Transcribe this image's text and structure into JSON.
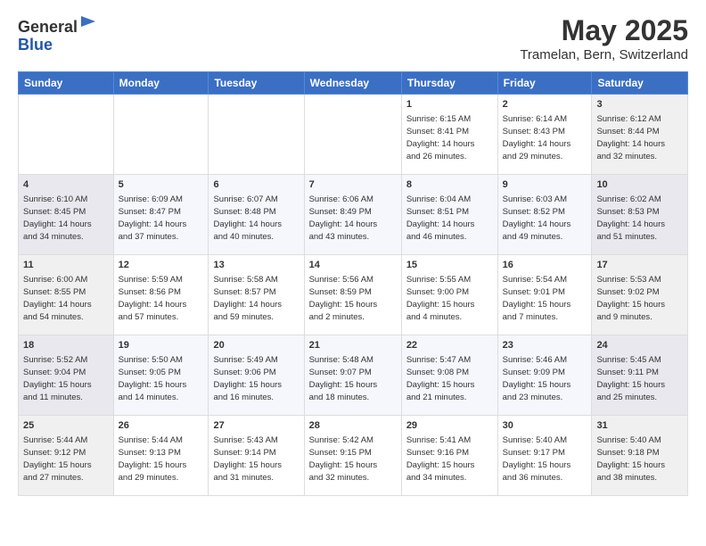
{
  "header": {
    "logo_general": "General",
    "logo_blue": "Blue",
    "main_title": "May 2025",
    "subtitle": "Tramelan, Bern, Switzerland"
  },
  "calendar": {
    "days_of_week": [
      "Sunday",
      "Monday",
      "Tuesday",
      "Wednesday",
      "Thursday",
      "Friday",
      "Saturday"
    ],
    "weeks": [
      [
        {
          "day": "",
          "info": ""
        },
        {
          "day": "",
          "info": ""
        },
        {
          "day": "",
          "info": ""
        },
        {
          "day": "",
          "info": ""
        },
        {
          "day": "1",
          "info": "Sunrise: 6:15 AM\nSunset: 8:41 PM\nDaylight: 14 hours\nand 26 minutes."
        },
        {
          "day": "2",
          "info": "Sunrise: 6:14 AM\nSunset: 8:43 PM\nDaylight: 14 hours\nand 29 minutes."
        },
        {
          "day": "3",
          "info": "Sunrise: 6:12 AM\nSunset: 8:44 PM\nDaylight: 14 hours\nand 32 minutes."
        }
      ],
      [
        {
          "day": "4",
          "info": "Sunrise: 6:10 AM\nSunset: 8:45 PM\nDaylight: 14 hours\nand 34 minutes."
        },
        {
          "day": "5",
          "info": "Sunrise: 6:09 AM\nSunset: 8:47 PM\nDaylight: 14 hours\nand 37 minutes."
        },
        {
          "day": "6",
          "info": "Sunrise: 6:07 AM\nSunset: 8:48 PM\nDaylight: 14 hours\nand 40 minutes."
        },
        {
          "day": "7",
          "info": "Sunrise: 6:06 AM\nSunset: 8:49 PM\nDaylight: 14 hours\nand 43 minutes."
        },
        {
          "day": "8",
          "info": "Sunrise: 6:04 AM\nSunset: 8:51 PM\nDaylight: 14 hours\nand 46 minutes."
        },
        {
          "day": "9",
          "info": "Sunrise: 6:03 AM\nSunset: 8:52 PM\nDaylight: 14 hours\nand 49 minutes."
        },
        {
          "day": "10",
          "info": "Sunrise: 6:02 AM\nSunset: 8:53 PM\nDaylight: 14 hours\nand 51 minutes."
        }
      ],
      [
        {
          "day": "11",
          "info": "Sunrise: 6:00 AM\nSunset: 8:55 PM\nDaylight: 14 hours\nand 54 minutes."
        },
        {
          "day": "12",
          "info": "Sunrise: 5:59 AM\nSunset: 8:56 PM\nDaylight: 14 hours\nand 57 minutes."
        },
        {
          "day": "13",
          "info": "Sunrise: 5:58 AM\nSunset: 8:57 PM\nDaylight: 14 hours\nand 59 minutes."
        },
        {
          "day": "14",
          "info": "Sunrise: 5:56 AM\nSunset: 8:59 PM\nDaylight: 15 hours\nand 2 minutes."
        },
        {
          "day": "15",
          "info": "Sunrise: 5:55 AM\nSunset: 9:00 PM\nDaylight: 15 hours\nand 4 minutes."
        },
        {
          "day": "16",
          "info": "Sunrise: 5:54 AM\nSunset: 9:01 PM\nDaylight: 15 hours\nand 7 minutes."
        },
        {
          "day": "17",
          "info": "Sunrise: 5:53 AM\nSunset: 9:02 PM\nDaylight: 15 hours\nand 9 minutes."
        }
      ],
      [
        {
          "day": "18",
          "info": "Sunrise: 5:52 AM\nSunset: 9:04 PM\nDaylight: 15 hours\nand 11 minutes."
        },
        {
          "day": "19",
          "info": "Sunrise: 5:50 AM\nSunset: 9:05 PM\nDaylight: 15 hours\nand 14 minutes."
        },
        {
          "day": "20",
          "info": "Sunrise: 5:49 AM\nSunset: 9:06 PM\nDaylight: 15 hours\nand 16 minutes."
        },
        {
          "day": "21",
          "info": "Sunrise: 5:48 AM\nSunset: 9:07 PM\nDaylight: 15 hours\nand 18 minutes."
        },
        {
          "day": "22",
          "info": "Sunrise: 5:47 AM\nSunset: 9:08 PM\nDaylight: 15 hours\nand 21 minutes."
        },
        {
          "day": "23",
          "info": "Sunrise: 5:46 AM\nSunset: 9:09 PM\nDaylight: 15 hours\nand 23 minutes."
        },
        {
          "day": "24",
          "info": "Sunrise: 5:45 AM\nSunset: 9:11 PM\nDaylight: 15 hours\nand 25 minutes."
        }
      ],
      [
        {
          "day": "25",
          "info": "Sunrise: 5:44 AM\nSunset: 9:12 PM\nDaylight: 15 hours\nand 27 minutes."
        },
        {
          "day": "26",
          "info": "Sunrise: 5:44 AM\nSunset: 9:13 PM\nDaylight: 15 hours\nand 29 minutes."
        },
        {
          "day": "27",
          "info": "Sunrise: 5:43 AM\nSunset: 9:14 PM\nDaylight: 15 hours\nand 31 minutes."
        },
        {
          "day": "28",
          "info": "Sunrise: 5:42 AM\nSunset: 9:15 PM\nDaylight: 15 hours\nand 32 minutes."
        },
        {
          "day": "29",
          "info": "Sunrise: 5:41 AM\nSunset: 9:16 PM\nDaylight: 15 hours\nand 34 minutes."
        },
        {
          "day": "30",
          "info": "Sunrise: 5:40 AM\nSunset: 9:17 PM\nDaylight: 15 hours\nand 36 minutes."
        },
        {
          "day": "31",
          "info": "Sunrise: 5:40 AM\nSunset: 9:18 PM\nDaylight: 15 hours\nand 38 minutes."
        }
      ]
    ]
  }
}
